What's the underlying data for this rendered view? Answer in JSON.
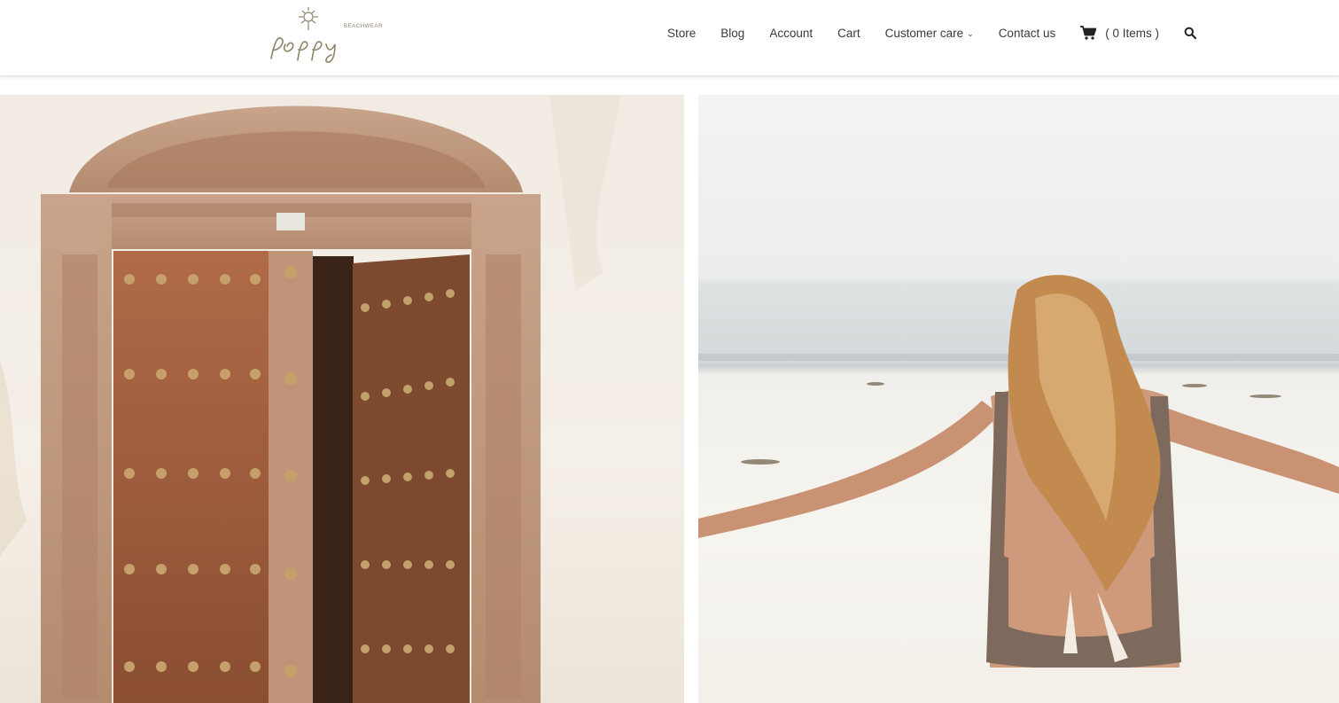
{
  "brand": {
    "name": "poppy",
    "tagline": "BEACHWEAR"
  },
  "nav": {
    "items": [
      {
        "label": "Store"
      },
      {
        "label": "Blog"
      },
      {
        "label": "Account"
      },
      {
        "label": "Cart"
      },
      {
        "label": "Customer care",
        "has_dropdown": true
      },
      {
        "label": "Contact us"
      }
    ],
    "cart_label": "( 0 Items )",
    "cart_icon": "shopping-cart-icon",
    "search_icon": "search-icon"
  },
  "gallery": {
    "left_image": "carved-wooden-door",
    "right_image": "woman-on-beach"
  },
  "colors": {
    "text": "#3a3a3a",
    "logo": "#8d8468",
    "header_bg": "#ffffff"
  }
}
